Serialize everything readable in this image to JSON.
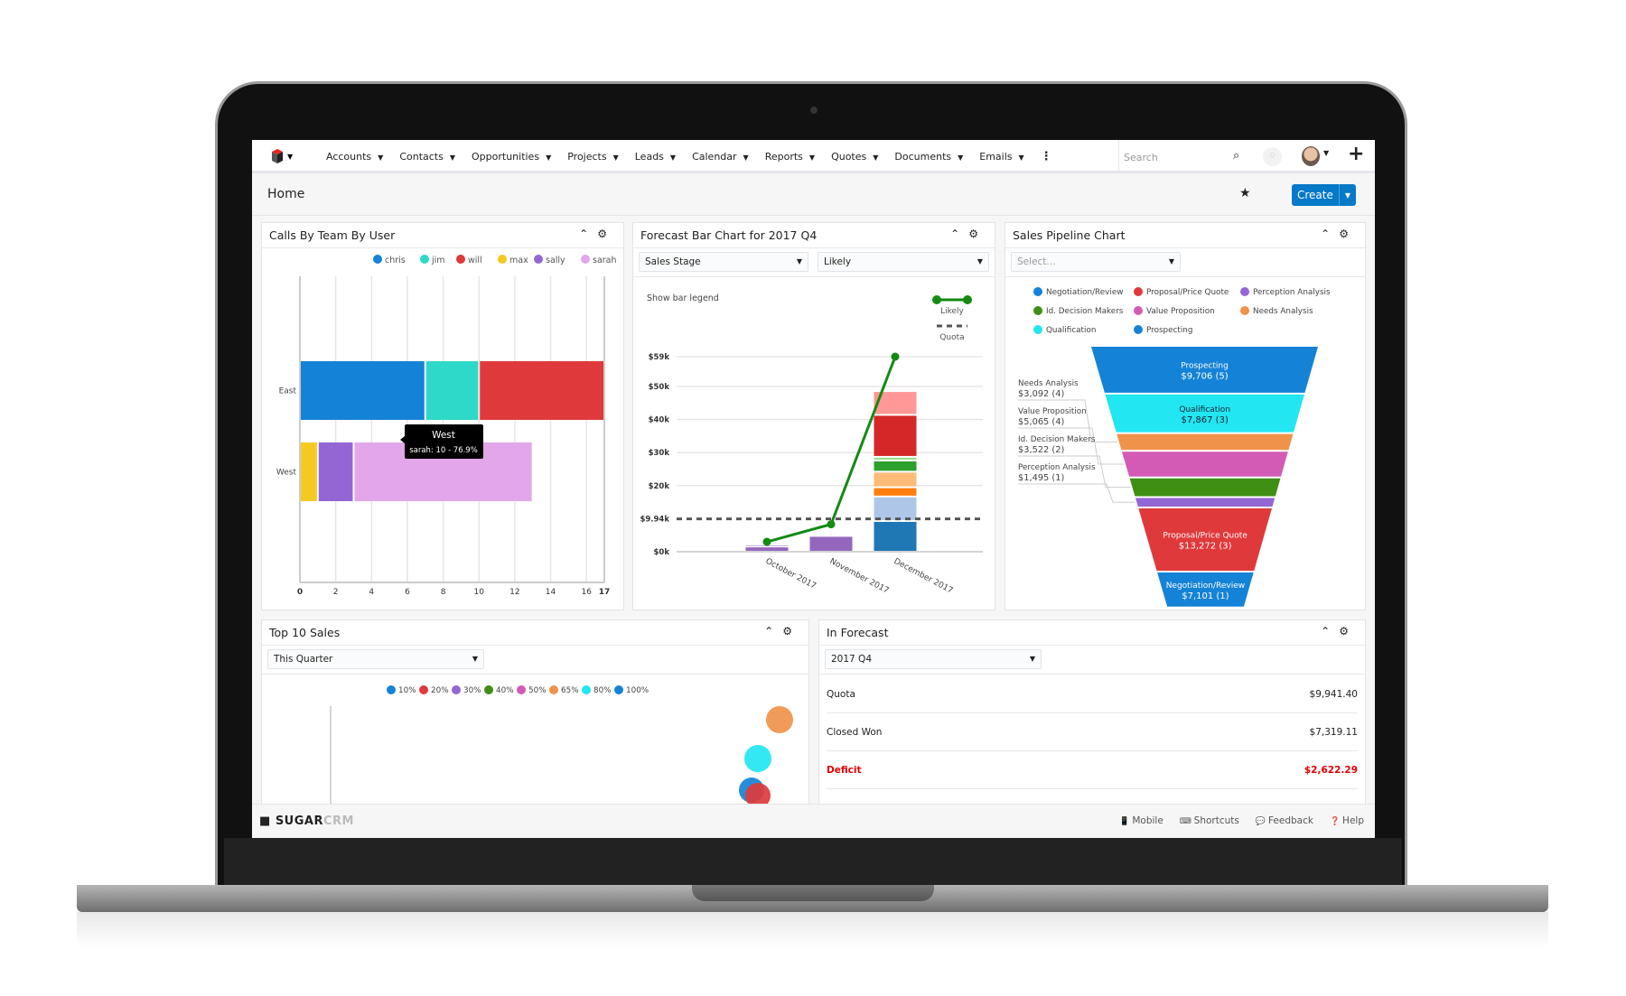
{
  "nav": {
    "items": [
      "Accounts",
      "Contacts",
      "Opportunities",
      "Projects",
      "Leads",
      "Calendar",
      "Reports",
      "Quotes",
      "Documents",
      "Emails"
    ],
    "search_placeholder": "Search",
    "notification_count": "0"
  },
  "header": {
    "title": "Home",
    "create_label": "Create"
  },
  "calls": {
    "title": "Calls By Team By User"
  },
  "forecast": {
    "title": "Forecast Bar Chart for 2017 Q4",
    "filter1": "Sales Stage",
    "filter2": "Likely",
    "show_legend": "Show bar legend"
  },
  "pipeline": {
    "title": "Sales Pipeline Chart",
    "select_placeholder": "Select..."
  },
  "top10": {
    "title": "Top 10 Sales",
    "filter": "This Quarter"
  },
  "inforecast": {
    "title": "In Forecast",
    "filter": "2017 Q4",
    "rows": [
      {
        "label": "Quota",
        "value": "$9,941.40"
      },
      {
        "label": "Closed Won",
        "value": "$7,319.11"
      },
      {
        "label": "Deficit",
        "value": "$2,622.29"
      }
    ],
    "deficit_color": "#e60000"
  },
  "footer": {
    "brand": "SUGAR",
    "brand2": "CRM",
    "links": [
      "Mobile",
      "Shortcuts",
      "Feedback",
      "Help"
    ]
  },
  "chart_data": [
    {
      "type": "bar",
      "orientation": "horizontal",
      "stacked": true,
      "categories": [
        "East",
        "West"
      ],
      "series": [
        {
          "name": "chris",
          "color": "#1483d7",
          "values": [
            7,
            0
          ]
        },
        {
          "name": "jim",
          "color": "#2ed9c9",
          "values": [
            3,
            0
          ]
        },
        {
          "name": "will",
          "color": "#e0393b",
          "values": [
            7,
            0
          ]
        },
        {
          "name": "max",
          "color": "#f5c922",
          "values": [
            0,
            1
          ]
        },
        {
          "name": "sally",
          "color": "#9466d5",
          "values": [
            0,
            2
          ]
        },
        {
          "name": "sarah",
          "color": "#e3a6ea",
          "values": [
            0,
            10
          ]
        }
      ],
      "xlim": [
        0,
        17
      ],
      "xticks": [
        "0",
        "2",
        "4",
        "6",
        "8",
        "10",
        "12",
        "14",
        "16",
        "17"
      ],
      "legend": "top-right",
      "grid": true,
      "tooltip": {
        "title": "West",
        "text": "sarah: 10 - 76.9%"
      }
    },
    {
      "type": "bar",
      "stacked": true,
      "categories": [
        "October 2017",
        "November 2017",
        "December 2017"
      ],
      "segments": [
        [
          {
            "color": "#9467bd",
            "value": 1.6
          },
          {
            "color": "#c5b0d5",
            "value": 0.6
          }
        ],
        [
          {
            "color": "#9467bd",
            "value": 4.8
          }
        ],
        [
          {
            "color": "#1f77b4",
            "value": 9.3
          },
          {
            "color": "#aec7e8",
            "value": 7.4
          },
          {
            "color": "#ff7f0e",
            "value": 2.8
          },
          {
            "color": "#ffbb78",
            "value": 4.7
          },
          {
            "color": "#2ca02c",
            "value": 3.4
          },
          {
            "color": "#98df8a",
            "value": 1.1
          },
          {
            "color": "#d62728",
            "value": 12.7
          },
          {
            "color": "#ff9896",
            "value": 7.2
          }
        ]
      ],
      "line": {
        "name": "Likely",
        "color": "#138a13",
        "values": [
          3.0,
          8.3,
          59
        ]
      },
      "quota": {
        "name": "Quota",
        "value": 9.94
      },
      "yticks": [
        {
          "v": 0,
          "label": "$0k"
        },
        {
          "v": 9.94,
          "label": "$9.94k"
        },
        {
          "v": 20,
          "label": "$20k"
        },
        {
          "v": 30,
          "label": "$30k"
        },
        {
          "v": 40,
          "label": "$40k"
        },
        {
          "v": 50,
          "label": "$50k"
        },
        {
          "v": 59,
          "label": "$59k"
        }
      ],
      "ylim": [
        0,
        59
      ],
      "yunit": "$k",
      "legend": "top-right"
    },
    {
      "type": "funnel",
      "stages": [
        {
          "name": "Prospecting",
          "amount": "$9,706 (5)",
          "value": 9706,
          "color": "#1483d7",
          "inside": true
        },
        {
          "name": "Qualification",
          "amount": "$7,867 (3)",
          "value": 7867,
          "color": "#22e6f2",
          "inside": true,
          "dark": true
        },
        {
          "name": "Needs Analysis",
          "amount": "$3,092 (4)",
          "value": 3092,
          "color": "#f0924a"
        },
        {
          "name": "Value Proposition",
          "amount": "$5,065 (4)",
          "value": 5065,
          "color": "#d35bb5"
        },
        {
          "name": "Id. Decision Makers",
          "amount": "$3,522 (2)",
          "value": 3522,
          "color": "#3f8f14"
        },
        {
          "name": "Perception Analysis",
          "amount": "$1,495 (1)",
          "value": 1495,
          "color": "#9466d5"
        },
        {
          "name": "Proposal/Price Quote",
          "amount": "$13,272 (3)",
          "value": 13272,
          "color": "#e0393b",
          "inside": true
        },
        {
          "name": "Negotiation/Review",
          "amount": "$7,101 (1)",
          "value": 7101,
          "color": "#1483d7",
          "inside": true
        }
      ],
      "legend": [
        "Negotiation/Review",
        "Proposal/Price Quote",
        "Perception Analysis",
        "Id. Decision Makers",
        "Value Proposition",
        "Needs Analysis",
        "Qualification",
        "Prospecting"
      ]
    },
    {
      "type": "scatter",
      "legend": [
        {
          "label": "10%",
          "color": "#1483d7"
        },
        {
          "label": "20%",
          "color": "#e0393b"
        },
        {
          "label": "30%",
          "color": "#9466d5"
        },
        {
          "label": "40%",
          "color": "#3f8f14"
        },
        {
          "label": "50%",
          "color": "#d35bb5"
        },
        {
          "label": "65%",
          "color": "#f0924a"
        },
        {
          "label": "80%",
          "color": "#22e6f2"
        },
        {
          "label": "100%",
          "color": "#1483d7"
        }
      ],
      "points": [
        {
          "probability": "65%"
        },
        {
          "probability": "80%"
        },
        {
          "probability": "10%"
        },
        {
          "probability": "20%"
        }
      ]
    }
  ]
}
